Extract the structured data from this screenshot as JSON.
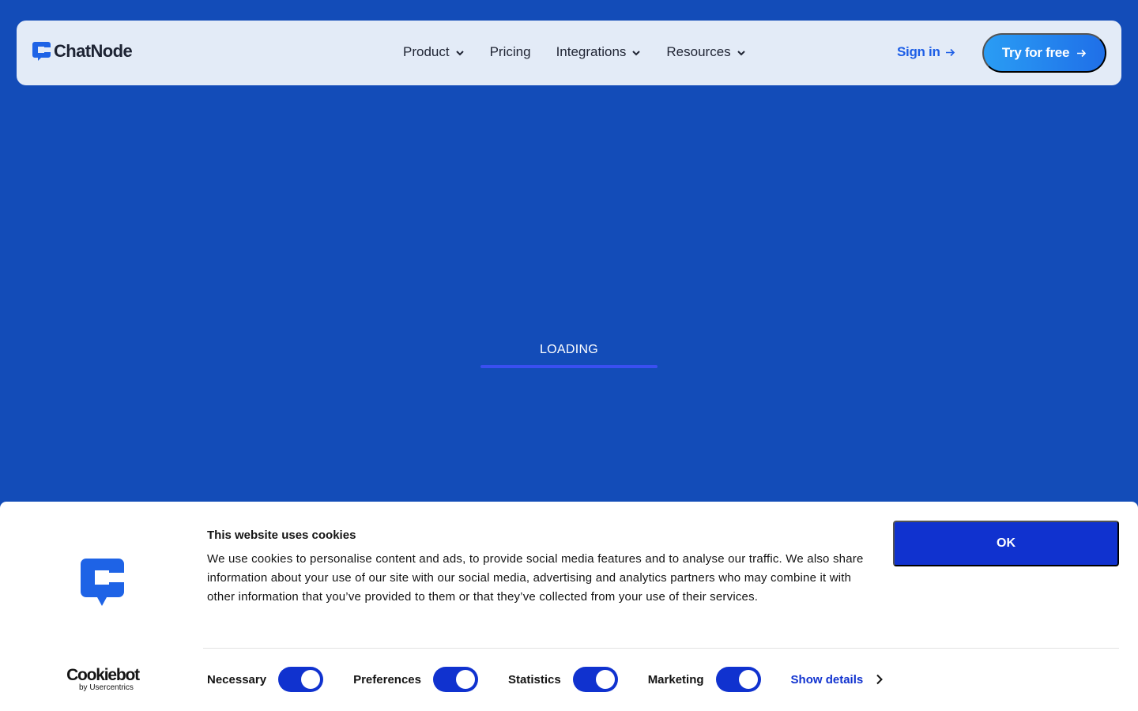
{
  "header": {
    "logo_text": "ChatNode",
    "nav": [
      {
        "label": "Product",
        "has_dropdown": true
      },
      {
        "label": "Pricing",
        "has_dropdown": false
      },
      {
        "label": "Integrations",
        "has_dropdown": true
      },
      {
        "label": "Resources",
        "has_dropdown": true
      }
    ],
    "sign_in_label": "Sign in",
    "try_label": "Try for free"
  },
  "loading": {
    "text": "LOADING",
    "progress_percent": 100
  },
  "cookie_banner": {
    "title": "This website uses cookies",
    "body": "We use cookies to personalise content and ads, to provide social media features and to analyse our traffic. We also share information about your use of our site with our social media, advertising and analytics partners who may combine it with other information that you’ve provided to them or that they’ve collected from your use of their services.",
    "ok_label": "OK",
    "brand_main": "Cookiebot",
    "brand_sub": "by Usercentrics",
    "toggles": [
      {
        "label": "Necessary",
        "on": true
      },
      {
        "label": "Preferences",
        "on": true
      },
      {
        "label": "Statistics",
        "on": true
      },
      {
        "label": "Marketing",
        "on": true
      }
    ],
    "show_details_label": "Show details"
  },
  "colors": {
    "page_bg": "#134cb8",
    "header_bg": "#e3ebf7",
    "accent": "#1d5ee6",
    "cookie_accent": "#1032cf"
  },
  "icons": [
    "chatnode-logo-icon",
    "chevron-down-icon",
    "arrow-right-icon",
    "cookiebot-logo-icon",
    "chevron-right-icon"
  ]
}
